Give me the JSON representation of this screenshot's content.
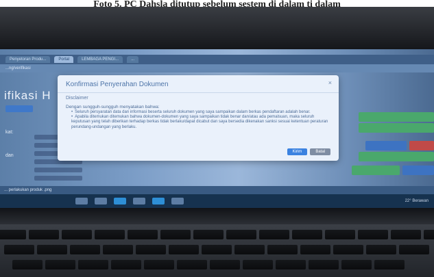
{
  "caption": "Foto 5. PC Dahsla ditutup sebelum sestem di dalam ti dalam",
  "browser": {
    "tabs": [
      {
        "label": "Penyetoran Produ..."
      },
      {
        "label": "Portal"
      },
      {
        "label": "LEMBAGA PENGI..."
      },
      {
        "label": "..."
      }
    ],
    "url": "...ng/verifikasi"
  },
  "page": {
    "title": "ifikasi H",
    "side_labels": [
      "kat:",
      "dan"
    ]
  },
  "modal": {
    "title": "Konfirmasi Penyerahan Dokumen",
    "close": "×",
    "subtitle": "Disclaimer",
    "intro": "Dengan sungguh-sungguh menyatakan bahwa:",
    "items": [
      "Seluruh persyaratan data dan informasi beserta seluruh dokumen yang saya sampaikan dalam berkas pendaftaran adalah benar.",
      "Apabila ditemukan ditemukan bahwa dokumen-dokumen yang saya sampaikan tidak benar dan/atau ada pemalsuan, maka seluruh keputusan yang telah diberikan terhadap berkas tidak berlaku/dapat dicabut dan saya bersedia dikenakan sanksi sesuai ketentuan peraturan perundang-undangan yang berlaku."
    ],
    "buttons": {
      "send": "Kirim",
      "cancel": "Batal"
    }
  },
  "status_strip": "... perlakukan produk .png",
  "taskbar": {
    "time": "22° Berawan"
  },
  "keyboard": {
    "row1": [
      "",
      "",
      "",
      "",
      "",
      "",
      "",
      "",
      "",
      "",
      "",
      "",
      "",
      ""
    ],
    "row2": [
      "",
      "",
      "",
      "",
      "",
      "",
      "",
      "",
      "",
      "",
      "",
      "",
      "",
      ""
    ],
    "row3": [
      "",
      "",
      "",
      "",
      "",
      "",
      "",
      "",
      "",
      "",
      "",
      "",
      "",
      ""
    ]
  }
}
